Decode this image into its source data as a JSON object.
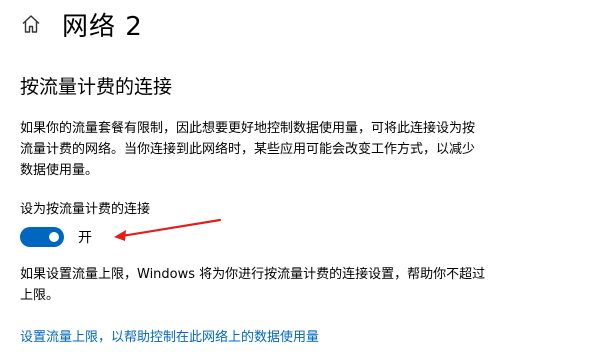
{
  "header": {
    "home_icon": "home-icon",
    "title": "网络 2"
  },
  "metered": {
    "section_title": "按流量计费的连接",
    "description": "如果你的流量套餐有限制，因此想要更好地控制数据使用量，可将此连接设为按流量计费的网络。当你连接到此网络时，某些应用可能会改变工作方式，以减少数据使用量。",
    "toggle_label": "设为按流量计费的连接",
    "toggle_on": true,
    "toggle_state_text": "开",
    "limit_note": "如果设置流量上限，Windows 将为你进行按流量计费的连接设置，帮助你不超过上限。",
    "limit_link": "设置流量上限，以帮助控制在此网络上的数据使用量"
  },
  "colors": {
    "accent": "#0067c0",
    "annotation_arrow": "#e0201b"
  }
}
